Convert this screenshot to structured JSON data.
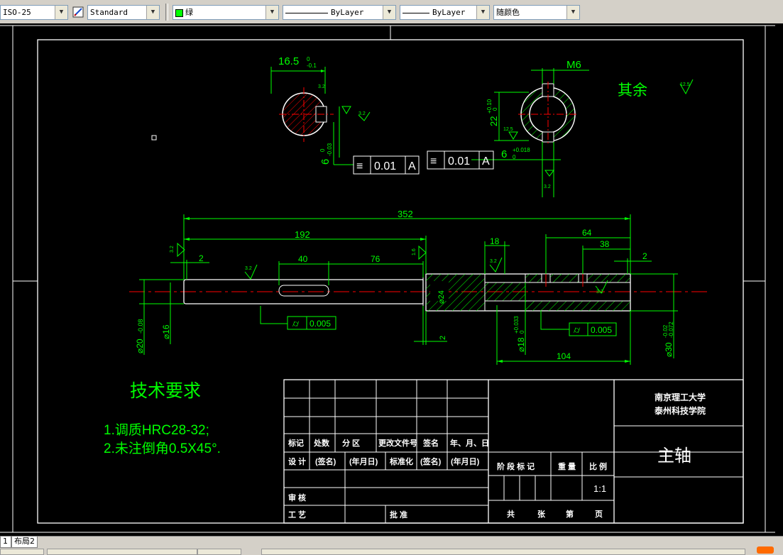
{
  "toolbar": {
    "dimstyle": "ISO-25",
    "textstyle": "Standard",
    "layer_color": "绿",
    "linetype": "ByLayer",
    "lineweight": "ByLayer",
    "plotstyle": "随颜色",
    "colors": {
      "layer_swatch": "#00ff00"
    }
  },
  "drawing": {
    "section1": {
      "width_dim": "16.5",
      "width_tol_upper": "0",
      "width_tol_lower": "-0.1",
      "depth_dim": "6",
      "depth_tol_upper": "0",
      "depth_tol_lower": "-0.03",
      "roughness_a": "3.2",
      "roughness_b": "3.2",
      "tol_symbol": "≡",
      "tol_value": "0.01",
      "tol_datum": "A"
    },
    "section2": {
      "thread_label": "M6",
      "height_dim": "22",
      "height_tol_upper": "+0.10",
      "height_tol_lower": "0",
      "width_dim": "6",
      "width_tol_upper": "+0.018",
      "width_tol_lower": "0",
      "roughness_a": "12.5",
      "roughness_b": "3.2",
      "tol_symbol": "≡",
      "tol_value": "0.01",
      "tol_datum": "A"
    },
    "rest_note": "其余",
    "rest_roughness": "12.5",
    "shaft": {
      "dim_total": "352",
      "dim_192": "192",
      "dim_2_left": "2",
      "dim_40": "40",
      "dim_76": "76",
      "dim_18": "18",
      "dim_64": "64",
      "dim_38": "38",
      "dim_2_right": "2",
      "dim_104": "104",
      "dim_2_bottom": "2",
      "dia_20": "⌀20",
      "dia_20_tol": "-0.08",
      "dia_16": "⌀16",
      "dia_24": "⌀24",
      "dia_18": "⌀18",
      "dia_18_tol_upper": "+0.033",
      "dia_18_tol_lower": "0",
      "dia_30": "⌀30",
      "dia_30_tol_upper": "-0.02",
      "dia_30_tol_lower": "-0.072",
      "rough_left": "3.2",
      "rough_mid": "3.2",
      "rough_right_top": "1.6",
      "rough_bore": "3.2",
      "rough_inner": "3.2",
      "cyl_tol_1": "0.005",
      "cyl_tol_2": "0.005"
    },
    "tech_req": {
      "title": "技术要求",
      "line1": "1.调质HRC28-32;",
      "line2": "2.未注倒角0.5X45°."
    },
    "title_block": {
      "h_mark": "标记",
      "h_count": "处数",
      "h_zone": "分 区",
      "h_docno": "更改文件号",
      "h_sign": "签名",
      "h_date": "年、月、日",
      "design": "设 计",
      "sign1": "(签名)",
      "date1": "(年月日)",
      "standardize": "标准化",
      "sign2": "(签名)",
      "date2": "(年月日)",
      "review": "审 核",
      "process": "工 艺",
      "approve": "批 准",
      "stage": "阶 段 标 记",
      "weight": "重 量",
      "scale": "比 例",
      "scale_value": "1:1",
      "total": "共",
      "sheets": "张",
      "no": "第",
      "page": "页",
      "school1": "南京理工大学",
      "school2": "泰州科技学院",
      "part_name": "主轴"
    }
  },
  "tabs": {
    "tab1": "1",
    "tab2": "布局2"
  }
}
